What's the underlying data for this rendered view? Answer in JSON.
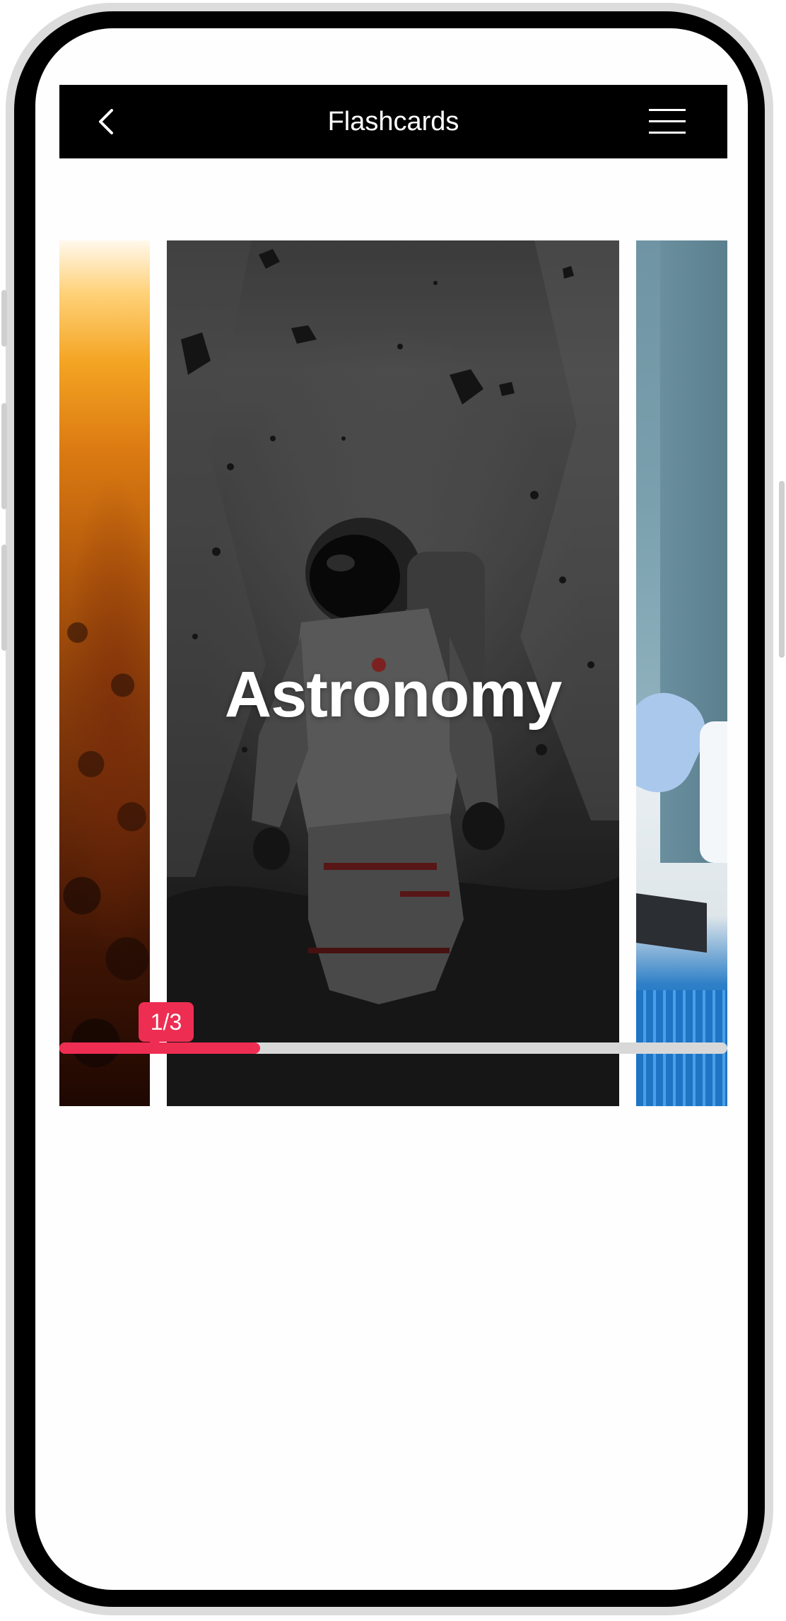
{
  "header": {
    "title": "Flashcards",
    "back_icon": "chevron-left-icon",
    "menu_icon": "hamburger-menu-icon"
  },
  "cards": [
    {
      "title": "",
      "image": "concert crowd"
    },
    {
      "title": "Astronomy",
      "image": "astronaut among asteroids"
    },
    {
      "title": "",
      "image": "laboratory pipette"
    }
  ],
  "progress": {
    "label": "1/3",
    "current": 1,
    "total": 3,
    "fill_fraction": 0.3
  },
  "colors": {
    "header_bg": "#000000",
    "accent": "#ee2d52",
    "track": "#d8d8d8"
  }
}
